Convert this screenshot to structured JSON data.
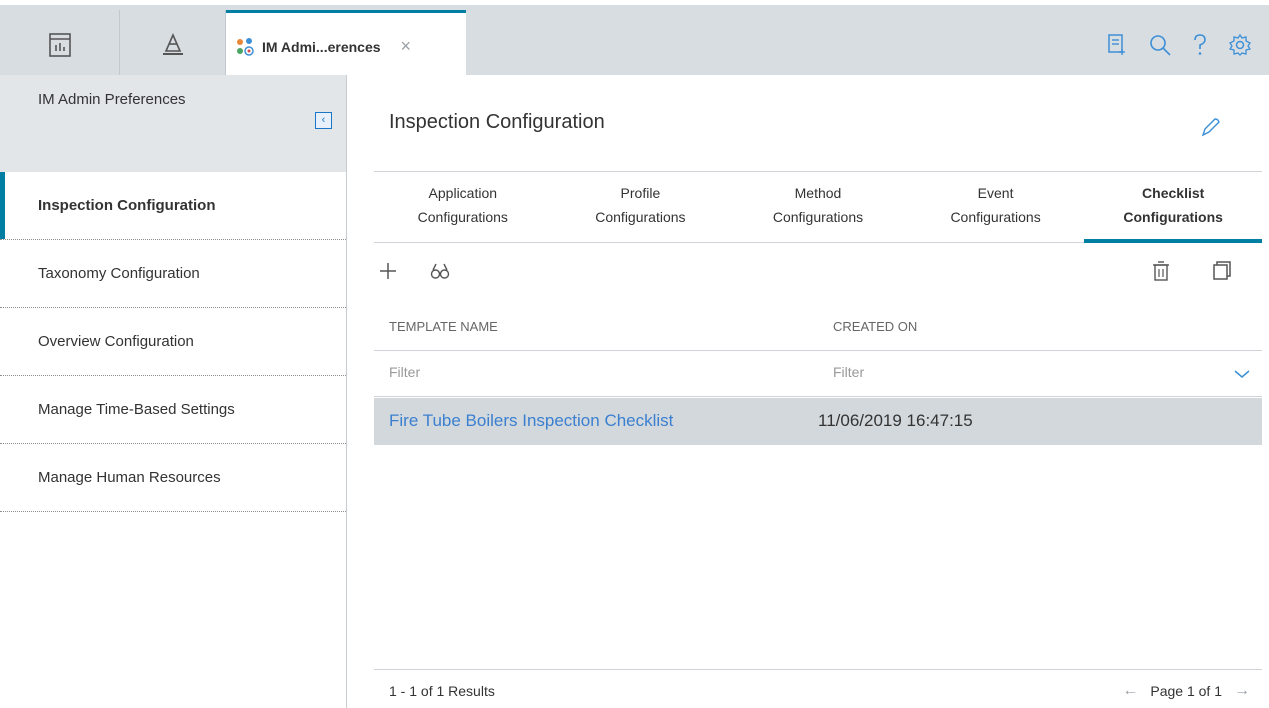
{
  "tabbar": {
    "active_tab_title": "IM Admi...erences",
    "close_glyph": "×",
    "icons": [
      "dashboard-icon",
      "asset-hierarchy-icon",
      "preferences-icon",
      "notes-icon",
      "search-icon",
      "help-icon",
      "settings-icon"
    ]
  },
  "sidebar": {
    "header": "IM Admin Preferences",
    "collapse_glyph": "‹",
    "items": [
      {
        "label": "Inspection Configuration",
        "active": true
      },
      {
        "label": "Taxonomy Configuration",
        "active": false
      },
      {
        "label": "Overview Configuration",
        "active": false
      },
      {
        "label": "Manage Time-Based Settings",
        "active": false
      },
      {
        "label": "Manage Human Resources",
        "active": false
      }
    ]
  },
  "main": {
    "title": "Inspection Configuration",
    "tabs": [
      {
        "line1": "Application",
        "line2": "Configurations",
        "active": false
      },
      {
        "line1": "Profile",
        "line2": "Configurations",
        "active": false
      },
      {
        "line1": "Method",
        "line2": "Configurations",
        "active": false
      },
      {
        "line1": "Event",
        "line2": "Configurations",
        "active": false
      },
      {
        "line1": "Checklist",
        "line2": "Configurations",
        "active": true
      }
    ],
    "toolbar_icons": [
      "add-icon",
      "binoculars-icon",
      "delete-icon",
      "copy-icon"
    ],
    "grid": {
      "columns": [
        "TEMPLATE NAME",
        "CREATED ON"
      ],
      "filters": [
        "Filter",
        "Filter"
      ],
      "rows": [
        {
          "template_name": "Fire Tube Boilers Inspection Checklist",
          "created_on": "11/06/2019 16:47:15"
        }
      ]
    },
    "footer": {
      "results": "1 - 1 of 1 Results",
      "page": "Page 1 of 1",
      "prev_glyph": "←",
      "next_glyph": "→"
    }
  },
  "colors": {
    "accent": "#007fa3",
    "link": "#3a7fd0",
    "icon_blue": "#3d8fd6",
    "selected_row": "#d3d8dc",
    "tabbar_bg": "#d8dde2"
  }
}
